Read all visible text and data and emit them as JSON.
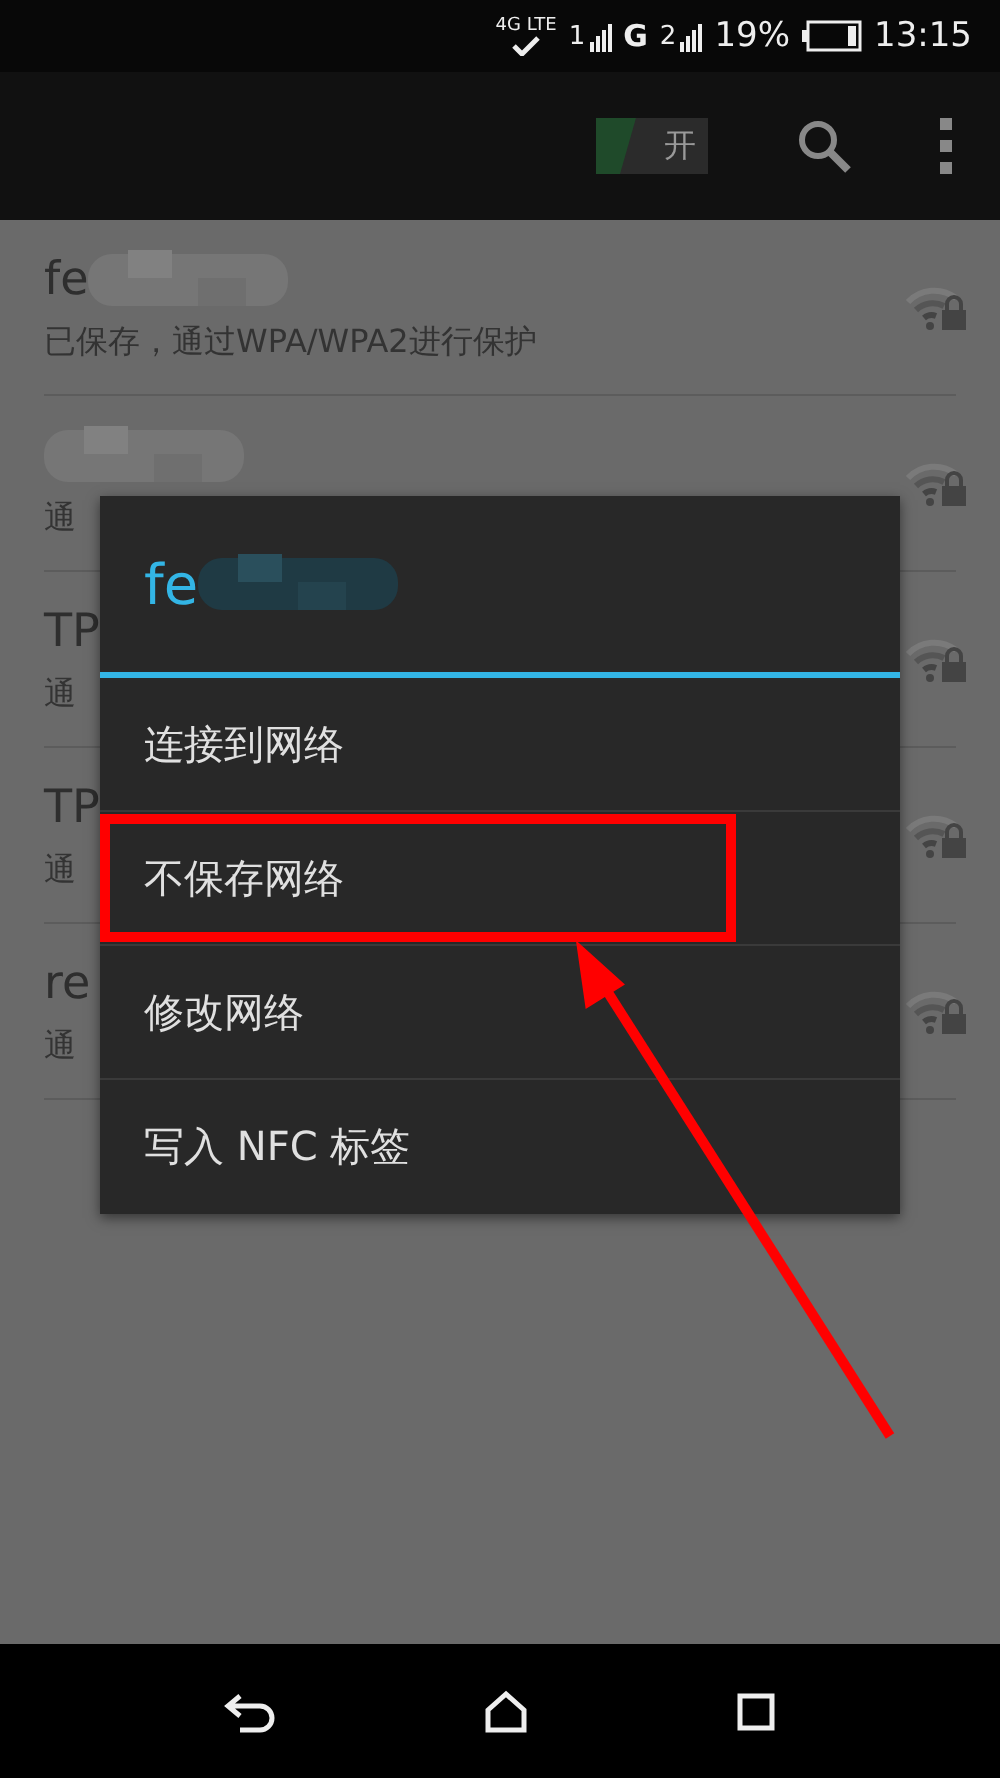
{
  "status_bar": {
    "network": "4G LTE",
    "sim1": "1",
    "sim2_type": "G",
    "sim2": "2",
    "battery": "19%",
    "time": "13:15"
  },
  "action_bar": {
    "toggle": {
      "label": "开",
      "on": true
    }
  },
  "networks": [
    {
      "name": "fe",
      "blurred": true,
      "status": "已保存，通过WPA/WPA2进行保护"
    },
    {
      "blurred": true,
      "status": "通"
    },
    {
      "name": "TP",
      "blurred": false,
      "status": "通"
    },
    {
      "name": "TP",
      "blurred": false,
      "status": "通"
    },
    {
      "name": "re",
      "blurred": false,
      "status": "通"
    }
  ],
  "dialog": {
    "title": "fe",
    "title_blurred": true,
    "items": [
      {
        "label": "连接到网络",
        "highlighted": false
      },
      {
        "label": "不保存网络",
        "highlighted": true
      },
      {
        "label": "修改网络",
        "highlighted": false
      },
      {
        "label": "写入 NFC 标签",
        "highlighted": false
      }
    ]
  },
  "annotation": {
    "arrow": true
  }
}
